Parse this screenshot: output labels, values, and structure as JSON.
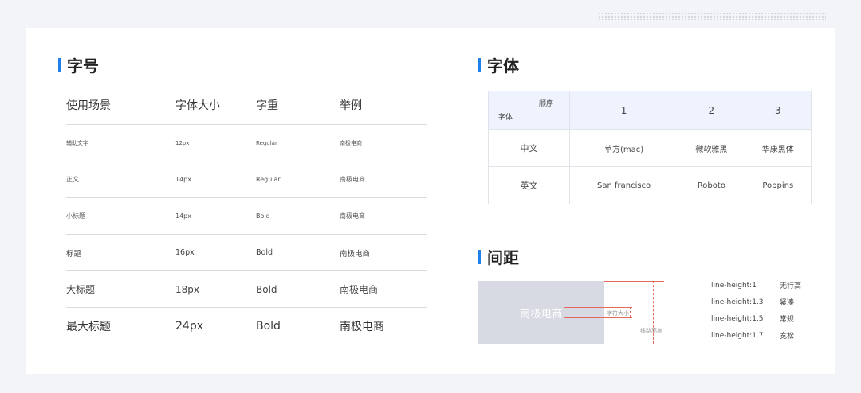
{
  "font_size": {
    "title": "字号",
    "headers": [
      "使用场景",
      "字体大小",
      "字重",
      "举例"
    ],
    "rows": [
      {
        "scene": "辅助文字",
        "size": "12px",
        "weight": "Regular",
        "example": "南极电商"
      },
      {
        "scene": "正文",
        "size": "14px",
        "weight": "Regular",
        "example": "南极电商"
      },
      {
        "scene": "小标题",
        "size": "14px",
        "weight": "Bold",
        "example": "南极电商"
      },
      {
        "scene": "标题",
        "size": "16px",
        "weight": "Bold",
        "example": "南极电商"
      },
      {
        "scene": "大标题",
        "size": "18px",
        "weight": "Bold",
        "example": "南极电商"
      },
      {
        "scene": "最大标题",
        "size": "24px",
        "weight": "Bold",
        "example": "南极电商"
      }
    ]
  },
  "font_family": {
    "title": "字体",
    "corner_top": "顺序",
    "corner_bottom": "字体",
    "columns": [
      "1",
      "2",
      "3"
    ],
    "rows": [
      {
        "label": "中文",
        "values": [
          "苹方(mac)",
          "微软雅黑",
          "华康黑体"
        ]
      },
      {
        "label": "英文",
        "values": [
          "San francisco",
          "Roboto",
          "Poppins"
        ]
      }
    ]
  },
  "spacing": {
    "title": "间距",
    "demo_text": "南极电商",
    "char_size_label": "字符大小",
    "line_height_label": "线路高度",
    "line_heights": [
      {
        "value": "line-height:1",
        "desc": "无行高"
      },
      {
        "value": "line-height:1.3",
        "desc": "紧凑"
      },
      {
        "value": "line-height:1.5",
        "desc": "常规"
      },
      {
        "value": "line-height:1.7",
        "desc": "宽松"
      }
    ]
  },
  "colors": {
    "accent": "#1e80e8",
    "guide": "#e5685f"
  }
}
